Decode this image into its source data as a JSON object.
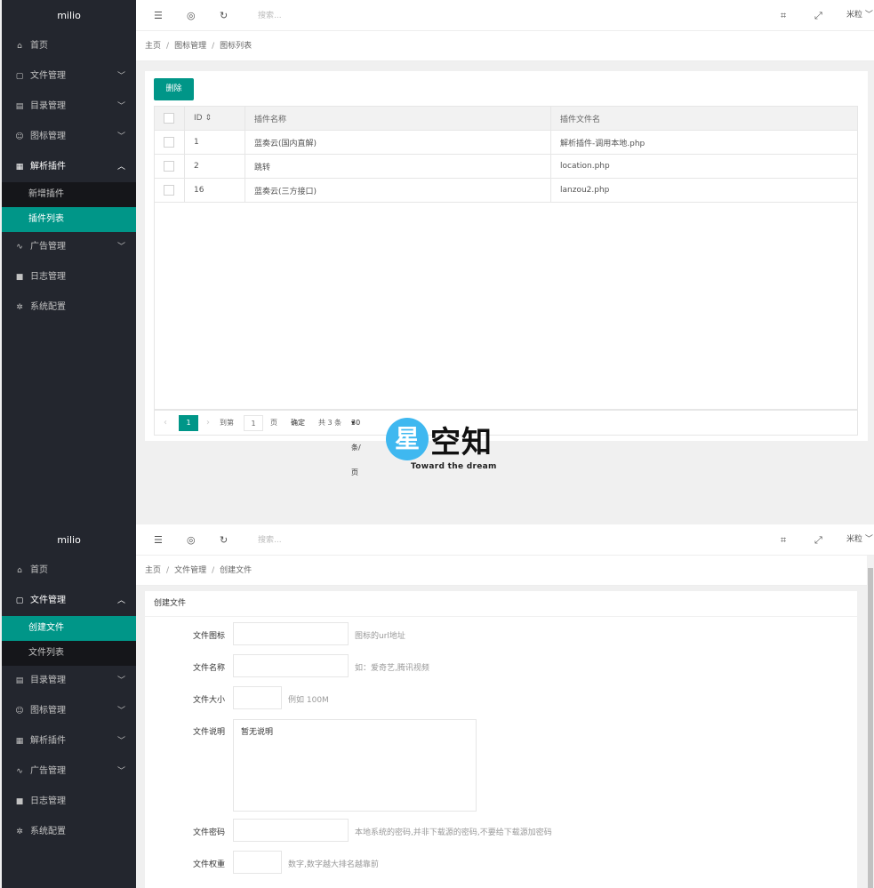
{
  "app_name": "milio",
  "topbar": {
    "search_placeholder": "搜索...",
    "user_name": "米粒",
    "icons": [
      "menu-fold-icon",
      "website-icon",
      "refresh-icon",
      "tag-icon",
      "fullscreen-icon",
      "chevron-down-icon"
    ]
  },
  "sidebar_a": {
    "items": [
      {
        "label": "首页",
        "icon": "home-icon"
      },
      {
        "label": "文件管理",
        "icon": "file-icon"
      },
      {
        "label": "目录管理",
        "icon": "folder-icon"
      },
      {
        "label": "图标管理",
        "icon": "smile-icon"
      },
      {
        "label": "解析插件",
        "icon": "apps-icon"
      },
      {
        "label": "广告管理",
        "icon": "chart-icon"
      },
      {
        "label": "日志管理",
        "icon": "log-icon"
      },
      {
        "label": "系统配置",
        "icon": "gear-icon"
      }
    ],
    "sub": [
      {
        "label": "新增插件"
      },
      {
        "label": "插件列表"
      }
    ]
  },
  "sidebar_b": {
    "sub": [
      {
        "label": "创建文件"
      },
      {
        "label": "文件列表"
      }
    ]
  },
  "breadcrumb_a": [
    "主页",
    "图标管理",
    "图标列表"
  ],
  "breadcrumb_b": [
    "主页",
    "文件管理",
    "创建文件"
  ],
  "table": {
    "delete_label": "删除",
    "headers": [
      "ID",
      "插件名称",
      "插件文件名"
    ],
    "rows": [
      {
        "id": "1",
        "name": "蓝奏云(国内直解)",
        "file": "解析插件-调用本地.php"
      },
      {
        "id": "2",
        "name": "跳转",
        "file": "location.php"
      },
      {
        "id": "16",
        "name": "蓝奏云(三方接口)",
        "file": "lanzou2.php"
      }
    ]
  },
  "pager": {
    "current": "1",
    "goto_label": "到第",
    "goto_value": "1",
    "page_unit": "页",
    "confirm": "确定",
    "total": "共 3 条",
    "per_page": "30 条/页"
  },
  "form": {
    "title": "创建文件",
    "fields": [
      {
        "label": "文件图标",
        "value": "",
        "hint": "图标的url地址"
      },
      {
        "label": "文件名称",
        "value": "",
        "hint": "如：爱奇艺,腾讯视频"
      },
      {
        "label": "文件大小",
        "value": "",
        "hint": "例如 100M"
      },
      {
        "label": "文件说明",
        "value": "暂无说明",
        "hint": ""
      },
      {
        "label": "文件密码",
        "value": "",
        "hint": "本地系统的密码,并非下载源的密码,不要给下载源加密码"
      },
      {
        "label": "文件权重",
        "value": "",
        "hint": "数字,数字越大排名越靠前"
      }
    ]
  },
  "watermark": {
    "char": "星",
    "text": "空知",
    "sub": "Toward the dream",
    "color": "#3fb8f0"
  },
  "colors": {
    "accent": "#009688",
    "sidebar": "#23262e",
    "subnav": "#15161a"
  }
}
